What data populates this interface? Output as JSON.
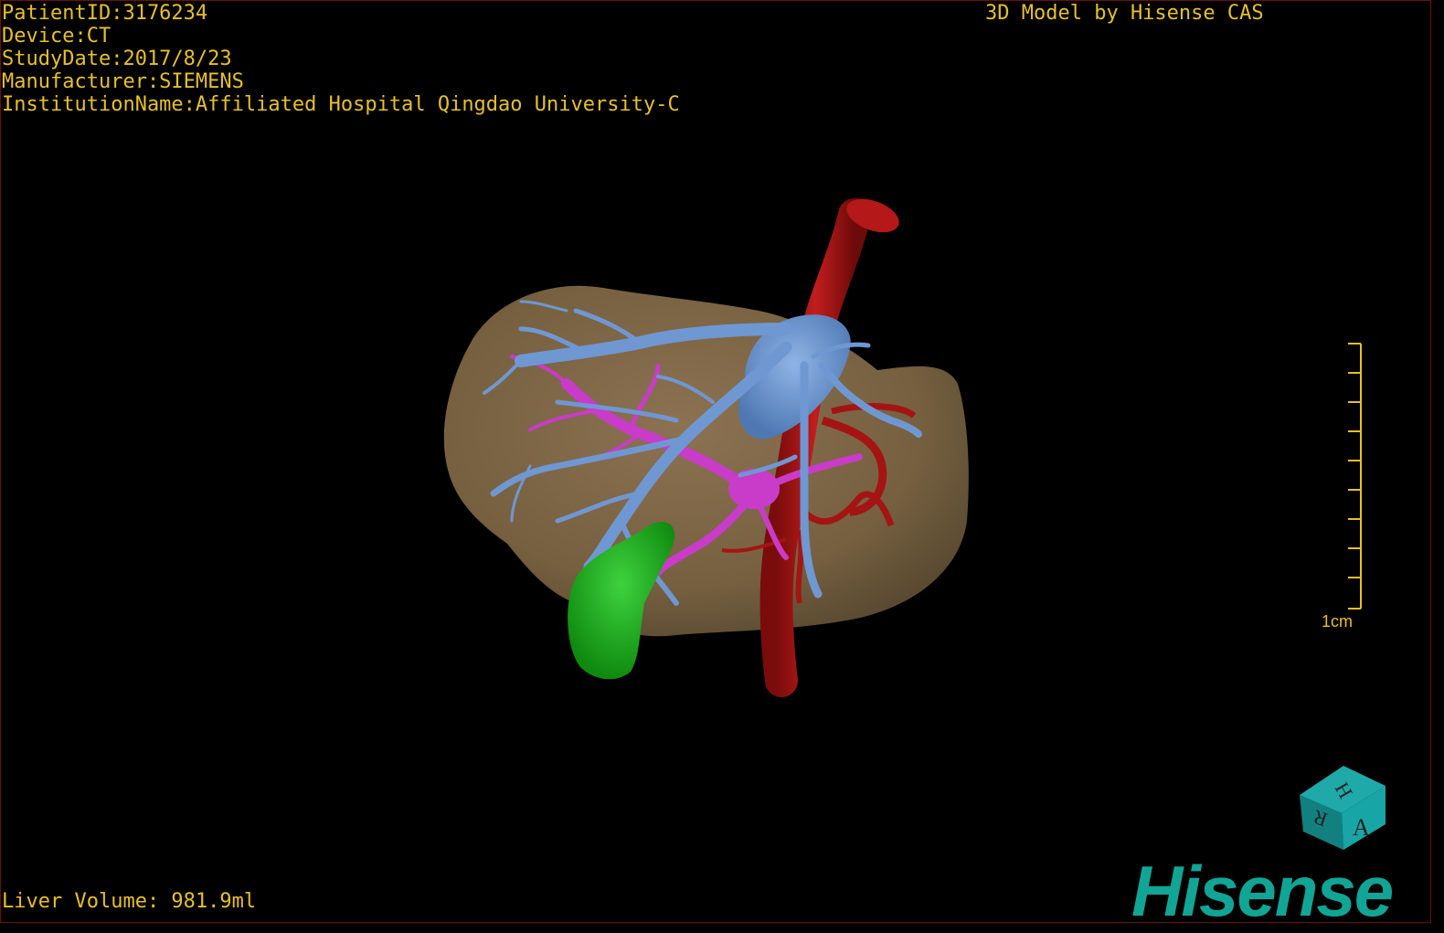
{
  "patient_info": {
    "patient_id": "PatientID:3176234",
    "device": "Device:CT",
    "study_date": "StudyDate:2017/8/23",
    "manufacturer": "Manufacturer:SIEMENS",
    "institution": "InstitutionName:Affiliated Hospital Qingdao University-C"
  },
  "credit": "3D Model by Hisense CAS",
  "liver_volume": "Liver Volume: 981.9ml",
  "scale_bar": {
    "label": "1cm",
    "ticks": 10
  },
  "orientation_cube": {
    "faces": [
      "H",
      "R",
      "A"
    ]
  },
  "logo": "Hisense",
  "colors": {
    "text": "#e6c02a",
    "liver": "#7d6447",
    "hepatic_vein": "#6f97d2",
    "portal_vein": "#c93bc9",
    "artery": "#a51414",
    "gallbladder": "#1ea81e",
    "logo": "#11a596"
  }
}
